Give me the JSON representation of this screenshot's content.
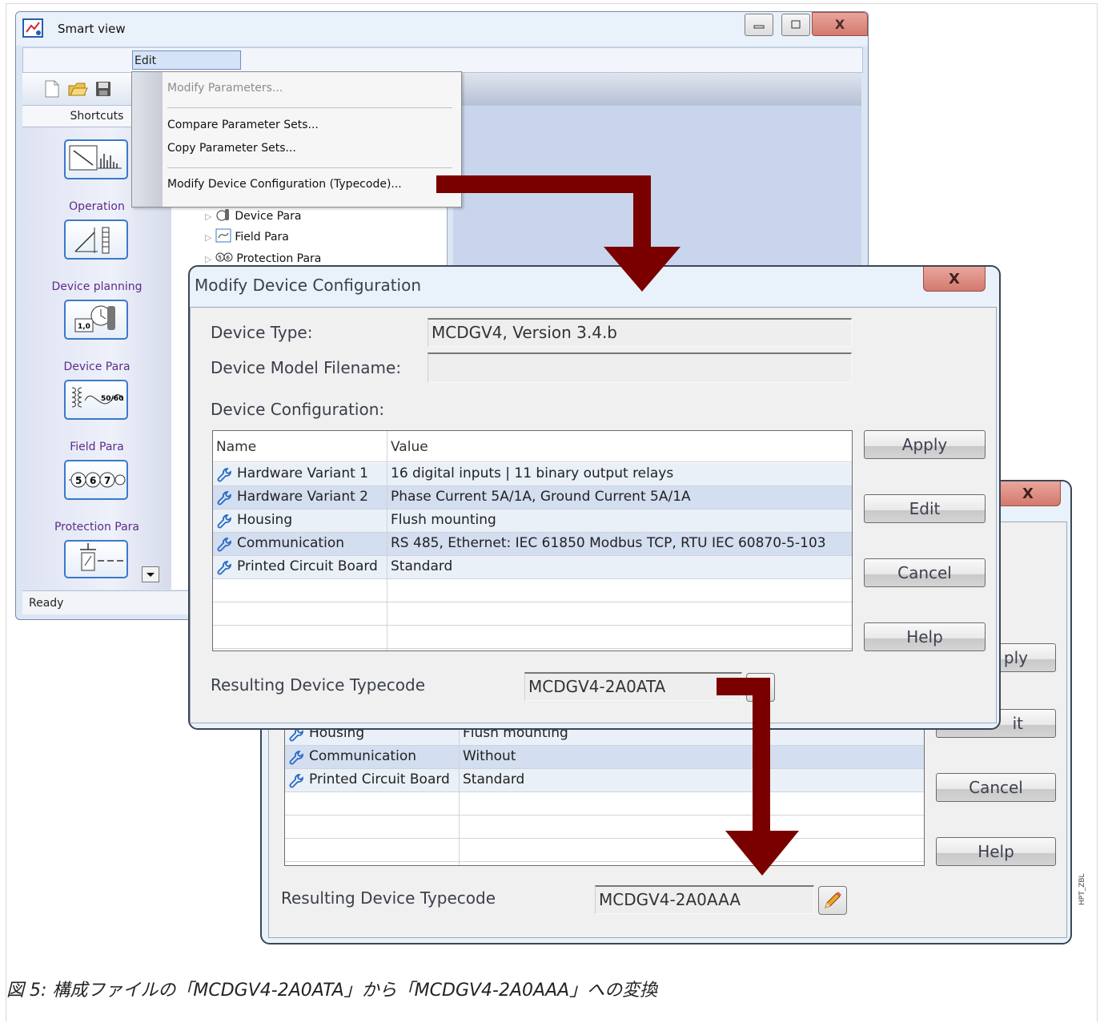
{
  "main_window": {
    "title": "Smart view",
    "menu_edit": "Edit",
    "shortcuts_header": "Shortcuts",
    "shortcuts": [
      "Operation",
      "Device planning",
      "Device Para",
      "Field Para",
      "Protection Para"
    ],
    "tree_items": [
      "Device Para",
      "Field Para",
      "Protection Para"
    ],
    "status": "Ready",
    "close_glyph": "X"
  },
  "edit_menu": {
    "items": [
      "Modify Parameters...",
      "Compare Parameter Sets...",
      "Copy Parameter Sets...",
      "Modify Device Configuration (Typecode)..."
    ]
  },
  "dialog_front": {
    "title": "Modify Device Configuration",
    "close_glyph": "X",
    "device_type_label": "Device Type:",
    "device_type_value": "MCDGV4, Version 3.4.b",
    "model_filename_label": "Device Model Filename:",
    "model_filename_value": "",
    "config_label": "Device Configuration:",
    "col_name": "Name",
    "col_value": "Value",
    "rows": [
      {
        "name": "Hardware Variant 1",
        "value": "16 digital inputs | 11 binary output relays"
      },
      {
        "name": "Hardware Variant 2",
        "value": "Phase Current 5A/1A, Ground Current 5A/1A"
      },
      {
        "name": "Housing",
        "value": "Flush mounting"
      },
      {
        "name": "Communication",
        "value": "RS 485, Ethernet: IEC 61850 Modbus TCP, RTU IEC 60870-5-103"
      },
      {
        "name": "Printed Circuit Board",
        "value": "Standard"
      }
    ],
    "buttons": {
      "apply": "Apply",
      "edit": "Edit",
      "cancel": "Cancel",
      "help": "Help"
    },
    "typecode_label": "Resulting Device Typecode",
    "typecode_value": "MCDGV4-2A0ATA"
  },
  "dialog_back": {
    "close_glyph": "X",
    "rows": [
      {
        "name": "Housing",
        "value": "Flush mounting"
      },
      {
        "name": "Communication",
        "value": "Without"
      },
      {
        "name": "Printed Circuit Board",
        "value": "Standard"
      }
    ],
    "buttons": {
      "apply_partial": "ply",
      "edit_partial": "it",
      "cancel": "Cancel",
      "help": "Help"
    },
    "typecode_label": "Resulting Device Typecode",
    "typecode_value": "MCDGV4-2A0AAA"
  },
  "side_tag": "HPT_ZBL",
  "caption": "図 5: 構成ファイルの「MCDGV4-2A0ATA」から「MCDGV4-2A0AAA」への変換",
  "colors": {
    "arrow": "#7a0000",
    "accent_blue": "#3b79c8",
    "close_red": "#d47a6e"
  }
}
